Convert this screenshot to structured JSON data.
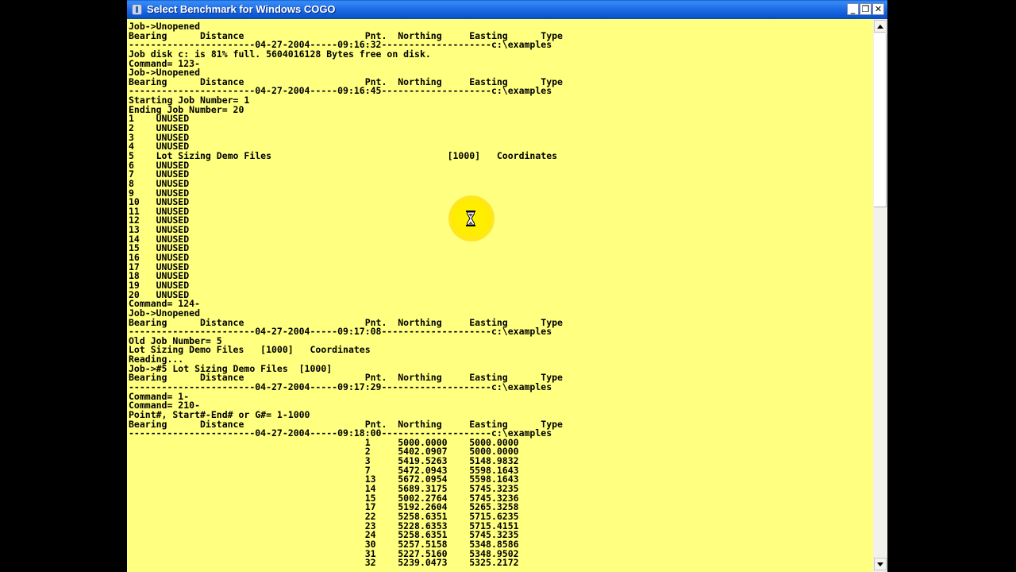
{
  "window": {
    "title": "Select Benchmark for Windows COGO",
    "buttons": {
      "minimize": "_",
      "maximize": "❐",
      "close": "✕"
    }
  },
  "icons": {
    "app": "app-icon",
    "cursor": "hourglass-icon"
  },
  "colors": {
    "console_bg": "#ffff80",
    "title_bar": "#0b55cf",
    "cursor_highlight": "#fff200"
  },
  "console_lines": [
    "Job->Unopened",
    "Bearing      Distance                      Pnt.  Northing     Easting      Type",
    "-----------------------04-27-2004-----09:16:32--------------------c:\\examples",
    "Job disk c: is 81% full. 5604016128 Bytes free on disk.",
    "Command= 123-",
    "Job->Unopened",
    "Bearing      Distance                      Pnt.  Northing     Easting      Type",
    "-----------------------04-27-2004-----09:16:45--------------------c:\\examples",
    "Starting Job Number= 1",
    "Ending Job Number= 20",
    "1    UNUSED",
    "2    UNUSED",
    "3    UNUSED",
    "4    UNUSED",
    "5    Lot Sizing Demo Files                                [1000]   Coordinates",
    "6    UNUSED",
    "7    UNUSED",
    "8    UNUSED",
    "9    UNUSED",
    "10   UNUSED",
    "11   UNUSED",
    "12   UNUSED",
    "13   UNUSED",
    "14   UNUSED",
    "15   UNUSED",
    "16   UNUSED",
    "17   UNUSED",
    "18   UNUSED",
    "19   UNUSED",
    "20   UNUSED",
    "Command= 124-",
    "Job->Unopened",
    "Bearing      Distance                      Pnt.  Northing     Easting      Type",
    "-----------------------04-27-2004-----09:17:08--------------------c:\\examples",
    "Old Job Number= 5",
    "Lot Sizing Demo Files   [1000]   Coordinates",
    "Reading...",
    "Job->#5 Lot Sizing Demo Files  [1000]",
    "Bearing      Distance                      Pnt.  Northing     Easting      Type",
    "-----------------------04-27-2004-----09:17:29--------------------c:\\examples",
    "Command= 1-",
    "Command= 210-",
    "Point#, Start#-End# or G#= 1-1000",
    "Bearing      Distance                      Pnt.  Northing     Easting      Type",
    "-----------------------04-27-2004-----09:18:00--------------------c:\\examples",
    "                                           1     5000.0000    5000.0000",
    "                                           2     5402.0907    5000.0000",
    "                                           3     5419.5263    5148.9832",
    "                                           7     5472.0943    5598.1643",
    "                                           13    5672.0954    5598.1643",
    "                                           14    5689.3175    5745.3235",
    "                                           15    5002.2764    5745.3236",
    "                                           17    5192.2604    5265.3258",
    "                                           22    5258.6351    5715.6235",
    "                                           23    5228.6353    5715.4151",
    "                                           24    5258.6351    5745.3235",
    "                                           30    5257.5158    5348.8586",
    "                                           31    5227.5160    5348.9502",
    "                                           32    5239.0473    5325.2172"
  ]
}
